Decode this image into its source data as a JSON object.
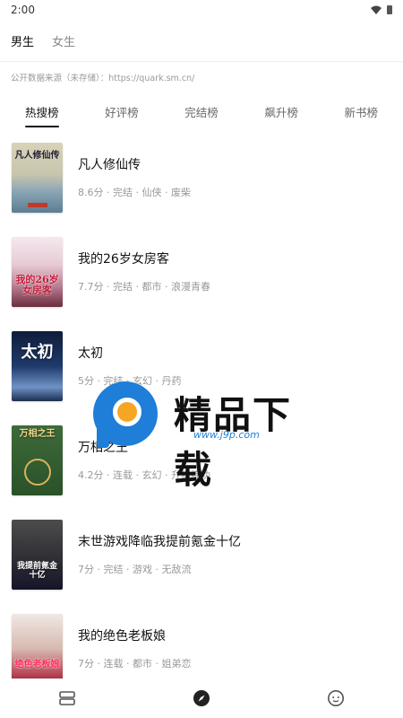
{
  "status_bar": {
    "time": "2:00"
  },
  "gender_tabs": [
    {
      "label": "男生",
      "active": true
    },
    {
      "label": "女生",
      "active": false
    }
  ],
  "source_note": "公开数据来源（未存储）：https://quark.sm.cn/",
  "rank_tabs": [
    {
      "label": "热搜榜",
      "active": true
    },
    {
      "label": "好评榜",
      "active": false
    },
    {
      "label": "完结榜",
      "active": false
    },
    {
      "label": "飙升榜",
      "active": false
    },
    {
      "label": "新书榜",
      "active": false
    }
  ],
  "books": [
    {
      "title": "凡人修仙传",
      "meta": "8.6分 · 完结 · 仙侠 · 废柴",
      "cover_text": "凡人修仙传"
    },
    {
      "title": "我的26岁女房客",
      "meta": "7.7分 · 完结 · 都市 · 浪漫青春",
      "cover_text": "我的26岁女房客"
    },
    {
      "title": "太初",
      "meta": "5分 · 完结 · 玄幻 · 丹药",
      "cover_text": "太初"
    },
    {
      "title": "万相之王",
      "meta": "4.2分 · 连载 · 玄幻 · 升级练功",
      "cover_text": "万相之王"
    },
    {
      "title": "末世游戏降临我提前氪金十亿",
      "meta": "7分 · 完结 · 游戏 · 无敌流",
      "cover_text": "我提前氪金十亿"
    },
    {
      "title": "我的绝色老板娘",
      "meta": "7分 · 连载 · 都市 · 姐弟恋",
      "cover_text": "绝色老板娘"
    }
  ],
  "watermark": {
    "brand": "精品下载",
    "url": "www.j9p.com"
  },
  "bottom_nav": [
    {
      "icon": "bookshelf-icon"
    },
    {
      "icon": "compass-icon",
      "active": true
    },
    {
      "icon": "smiley-icon"
    }
  ]
}
